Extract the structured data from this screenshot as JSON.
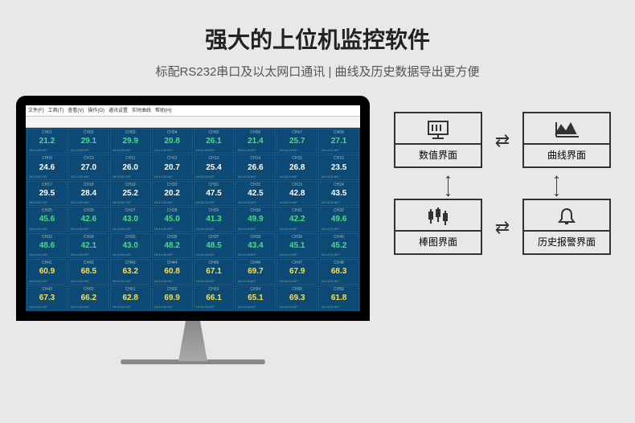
{
  "title": "强大的上位机监控软件",
  "subtitle": "标配RS232串口及以太网口通讯 | 曲线及历史数据导出更方便",
  "menu": [
    "文件(F)",
    "工具(T)",
    "查看(V)",
    "操作(O)",
    "通讯设置",
    "实时曲线",
    "帮助(H)"
  ],
  "timestamp": "16:14:02.697",
  "channels": [
    {
      "ch": "CH01",
      "v": "21.2",
      "c": "green"
    },
    {
      "ch": "CH02",
      "v": "29.1",
      "c": "green"
    },
    {
      "ch": "CH03",
      "v": "29.9",
      "c": "green"
    },
    {
      "ch": "CH04",
      "v": "20.8",
      "c": "green"
    },
    {
      "ch": "CH05",
      "v": "26.1",
      "c": "green"
    },
    {
      "ch": "CH06",
      "v": "21.4",
      "c": "green"
    },
    {
      "ch": "CH07",
      "v": "25.7",
      "c": "green"
    },
    {
      "ch": "CH08",
      "v": "27.1",
      "c": "green"
    },
    {
      "ch": "CH09",
      "v": "24.6",
      "c": "white"
    },
    {
      "ch": "CH10",
      "v": "27.0",
      "c": "white"
    },
    {
      "ch": "CH11",
      "v": "26.0",
      "c": "white"
    },
    {
      "ch": "CH12",
      "v": "20.7",
      "c": "white"
    },
    {
      "ch": "CH13",
      "v": "25.4",
      "c": "white"
    },
    {
      "ch": "CH14",
      "v": "26.6",
      "c": "white"
    },
    {
      "ch": "CH15",
      "v": "26.8",
      "c": "white"
    },
    {
      "ch": "CH16",
      "v": "23.5",
      "c": "white"
    },
    {
      "ch": "CH17",
      "v": "29.5",
      "c": "white"
    },
    {
      "ch": "CH18",
      "v": "28.4",
      "c": "white"
    },
    {
      "ch": "CH19",
      "v": "25.2",
      "c": "white"
    },
    {
      "ch": "CH20",
      "v": "20.2",
      "c": "white"
    },
    {
      "ch": "CH21",
      "v": "47.5",
      "c": "white"
    },
    {
      "ch": "CH22",
      "v": "42.5",
      "c": "white"
    },
    {
      "ch": "CH23",
      "v": "42.8",
      "c": "white"
    },
    {
      "ch": "CH24",
      "v": "43.5",
      "c": "white"
    },
    {
      "ch": "CH25",
      "v": "45.6",
      "c": "green"
    },
    {
      "ch": "CH26",
      "v": "42.6",
      "c": "green"
    },
    {
      "ch": "CH27",
      "v": "43.0",
      "c": "green"
    },
    {
      "ch": "CH28",
      "v": "45.0",
      "c": "green"
    },
    {
      "ch": "CH29",
      "v": "41.3",
      "c": "green"
    },
    {
      "ch": "CH30",
      "v": "49.9",
      "c": "green"
    },
    {
      "ch": "CH31",
      "v": "42.2",
      "c": "green"
    },
    {
      "ch": "CH32",
      "v": "49.6",
      "c": "green"
    },
    {
      "ch": "CH33",
      "v": "48.6",
      "c": "green"
    },
    {
      "ch": "CH34",
      "v": "42.1",
      "c": "green"
    },
    {
      "ch": "CH35",
      "v": "43.0",
      "c": "green"
    },
    {
      "ch": "CH36",
      "v": "48.2",
      "c": "green"
    },
    {
      "ch": "CH37",
      "v": "48.5",
      "c": "green"
    },
    {
      "ch": "CH38",
      "v": "43.4",
      "c": "green"
    },
    {
      "ch": "CH39",
      "v": "45.1",
      "c": "green"
    },
    {
      "ch": "CH40",
      "v": "45.2",
      "c": "green"
    },
    {
      "ch": "CH41",
      "v": "60.9",
      "c": "yellow"
    },
    {
      "ch": "CH42",
      "v": "68.5",
      "c": "yellow"
    },
    {
      "ch": "CH43",
      "v": "63.2",
      "c": "yellow"
    },
    {
      "ch": "CH44",
      "v": "60.8",
      "c": "yellow"
    },
    {
      "ch": "CH45",
      "v": "67.1",
      "c": "yellow"
    },
    {
      "ch": "CH46",
      "v": "69.7",
      "c": "yellow"
    },
    {
      "ch": "CH47",
      "v": "67.9",
      "c": "yellow"
    },
    {
      "ch": "CH48",
      "v": "68.3",
      "c": "yellow"
    },
    {
      "ch": "CH49",
      "v": "67.3",
      "c": "yellow"
    },
    {
      "ch": "CH50",
      "v": "66.2",
      "c": "yellow"
    },
    {
      "ch": "CH51",
      "v": "62.8",
      "c": "yellow"
    },
    {
      "ch": "CH52",
      "v": "69.9",
      "c": "yellow"
    },
    {
      "ch": "CH53",
      "v": "66.1",
      "c": "yellow"
    },
    {
      "ch": "CH54",
      "v": "65.1",
      "c": "yellow"
    },
    {
      "ch": "CH55",
      "v": "69.3",
      "c": "yellow"
    },
    {
      "ch": "CH56",
      "v": "61.8",
      "c": "yellow"
    }
  ],
  "boxes": {
    "numeric": "数值界面",
    "curve": "曲线界面",
    "bar": "棒图界面",
    "alarm": "历史报警界面"
  }
}
